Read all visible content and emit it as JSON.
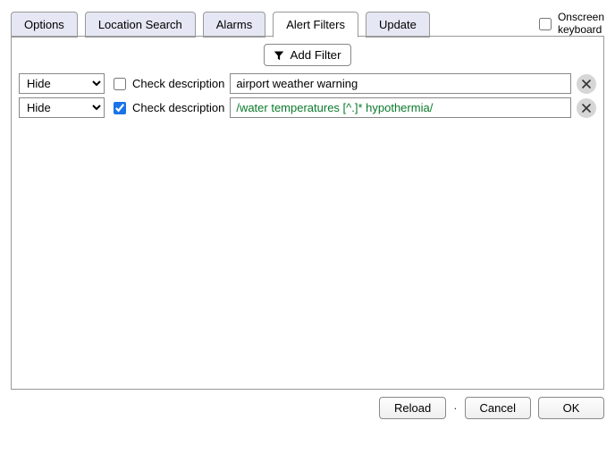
{
  "tabs": {
    "options": "Options",
    "location_search": "Location Search",
    "alarms": "Alarms",
    "alert_filters": "Alert Filters",
    "update": "Update"
  },
  "onscreen_keyboard": {
    "line1": "Onscreen",
    "line2": "keyboard",
    "checked": false
  },
  "add_filter_label": "Add Filter",
  "check_description_label": "Check description",
  "filters": [
    {
      "action": "Hide",
      "check_description": false,
      "pattern": "airport weather warning"
    },
    {
      "action": "Hide",
      "check_description": true,
      "pattern": "/water temperatures [^.]* hypothermia/"
    }
  ],
  "footer": {
    "reload": "Reload",
    "cancel": "Cancel",
    "ok": "OK"
  }
}
